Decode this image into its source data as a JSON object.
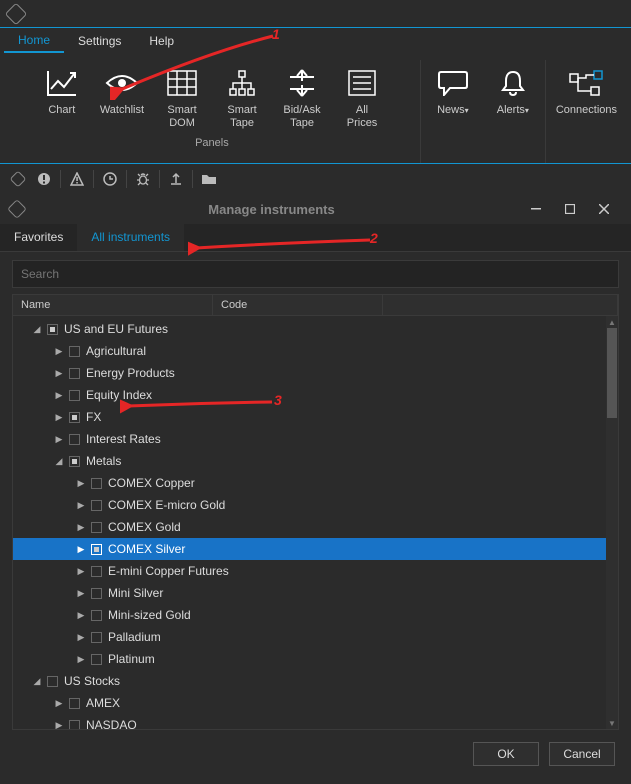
{
  "menubar": {
    "home": "Home",
    "settings": "Settings",
    "help": "Help"
  },
  "ribbon": {
    "chart": "Chart",
    "watchlist": "Watchlist",
    "smartdom": "Smart\nDOM",
    "smarttape": "Smart\nTape",
    "bidask": "Bid/Ask\nTape",
    "allprices": "All\nPrices",
    "news": "News",
    "alerts": "Alerts",
    "connections": "Connections",
    "panels_label": "Panels"
  },
  "dialog": {
    "title": "Manage instruments",
    "tab_favorites": "Favorites",
    "tab_all": "All instruments",
    "search_placeholder": "Search",
    "col_name": "Name",
    "col_code": "Code",
    "ok": "OK",
    "cancel": "Cancel"
  },
  "tree": {
    "us_eu_futures": "US and EU Futures",
    "agricultural": "Agricultural",
    "energy": "Energy Products",
    "equity": "Equity Index",
    "fx": "FX",
    "interest": "Interest Rates",
    "metals": "Metals",
    "comex_copper": "COMEX Copper",
    "comex_emicro_gold": "COMEX E-micro Gold",
    "comex_gold": "COMEX Gold",
    "comex_silver": "COMEX Silver",
    "emini_copper": "E-mini Copper Futures",
    "mini_silver": "Mini Silver",
    "mini_gold": "Mini-sized Gold",
    "palladium": "Palladium",
    "platinum": "Platinum",
    "us_stocks": "US Stocks",
    "amex": "AMEX",
    "nasdaq": "NASDAQ"
  },
  "annotations": {
    "a1": "1",
    "a2": "2",
    "a3": "3"
  }
}
